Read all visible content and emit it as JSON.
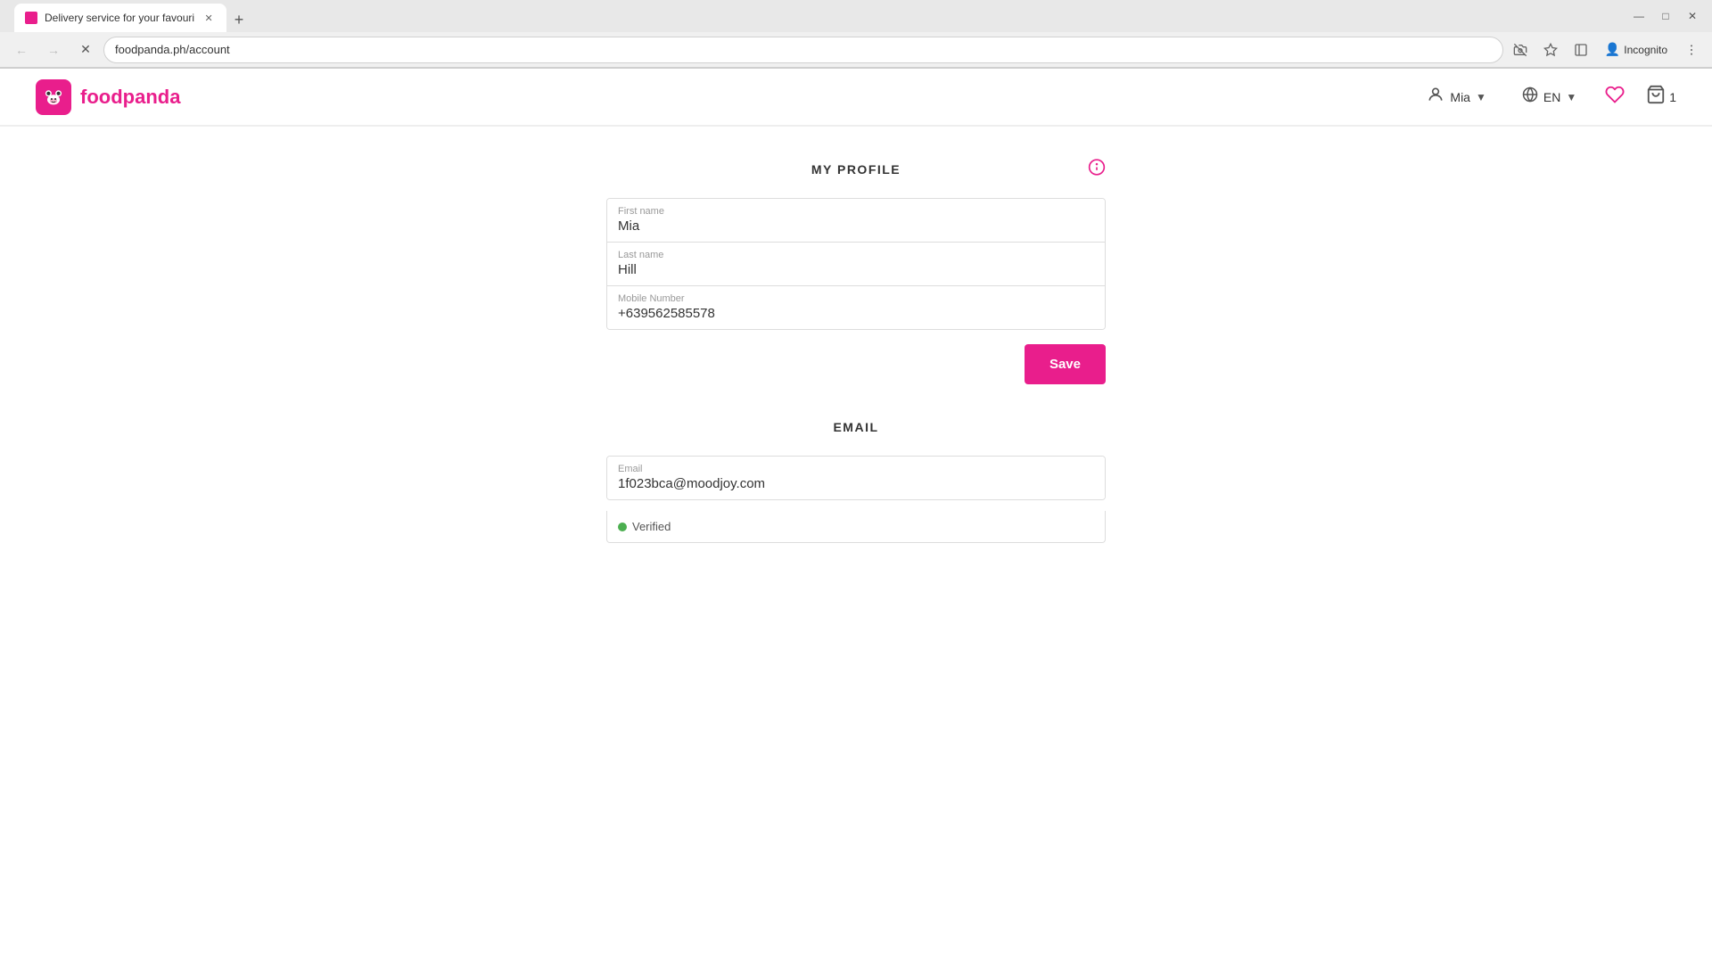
{
  "browser": {
    "tab_title": "Delivery service for your favouri",
    "tab_favicon": "🐼",
    "url": "foodpanda.ph/account",
    "new_tab_label": "+",
    "nav": {
      "back_label": "←",
      "forward_label": "→",
      "refresh_label": "✕",
      "home_label": "⌂"
    },
    "address_bar_actions": {
      "camera_off": "📷",
      "star": "☆",
      "sidebar": "⬜",
      "profile": "Incognito",
      "profile_icon": "👤",
      "menu": "⋮"
    }
  },
  "header": {
    "logo_text": "foodpanda",
    "logo_panda": "🐼",
    "user_name": "Mia",
    "language": "EN",
    "cart_count": "1"
  },
  "profile_section": {
    "title": "MY PROFILE",
    "first_name_label": "First name",
    "first_name_value": "Mia",
    "last_name_label": "Last name",
    "last_name_value": "Hill",
    "mobile_label": "Mobile Number",
    "mobile_value": "+639562585578",
    "save_button": "Save"
  },
  "email_section": {
    "title": "EMAIL",
    "email_label": "Email",
    "email_value": "1f023bca@moodjoy.com",
    "verified_label": "Verified"
  }
}
